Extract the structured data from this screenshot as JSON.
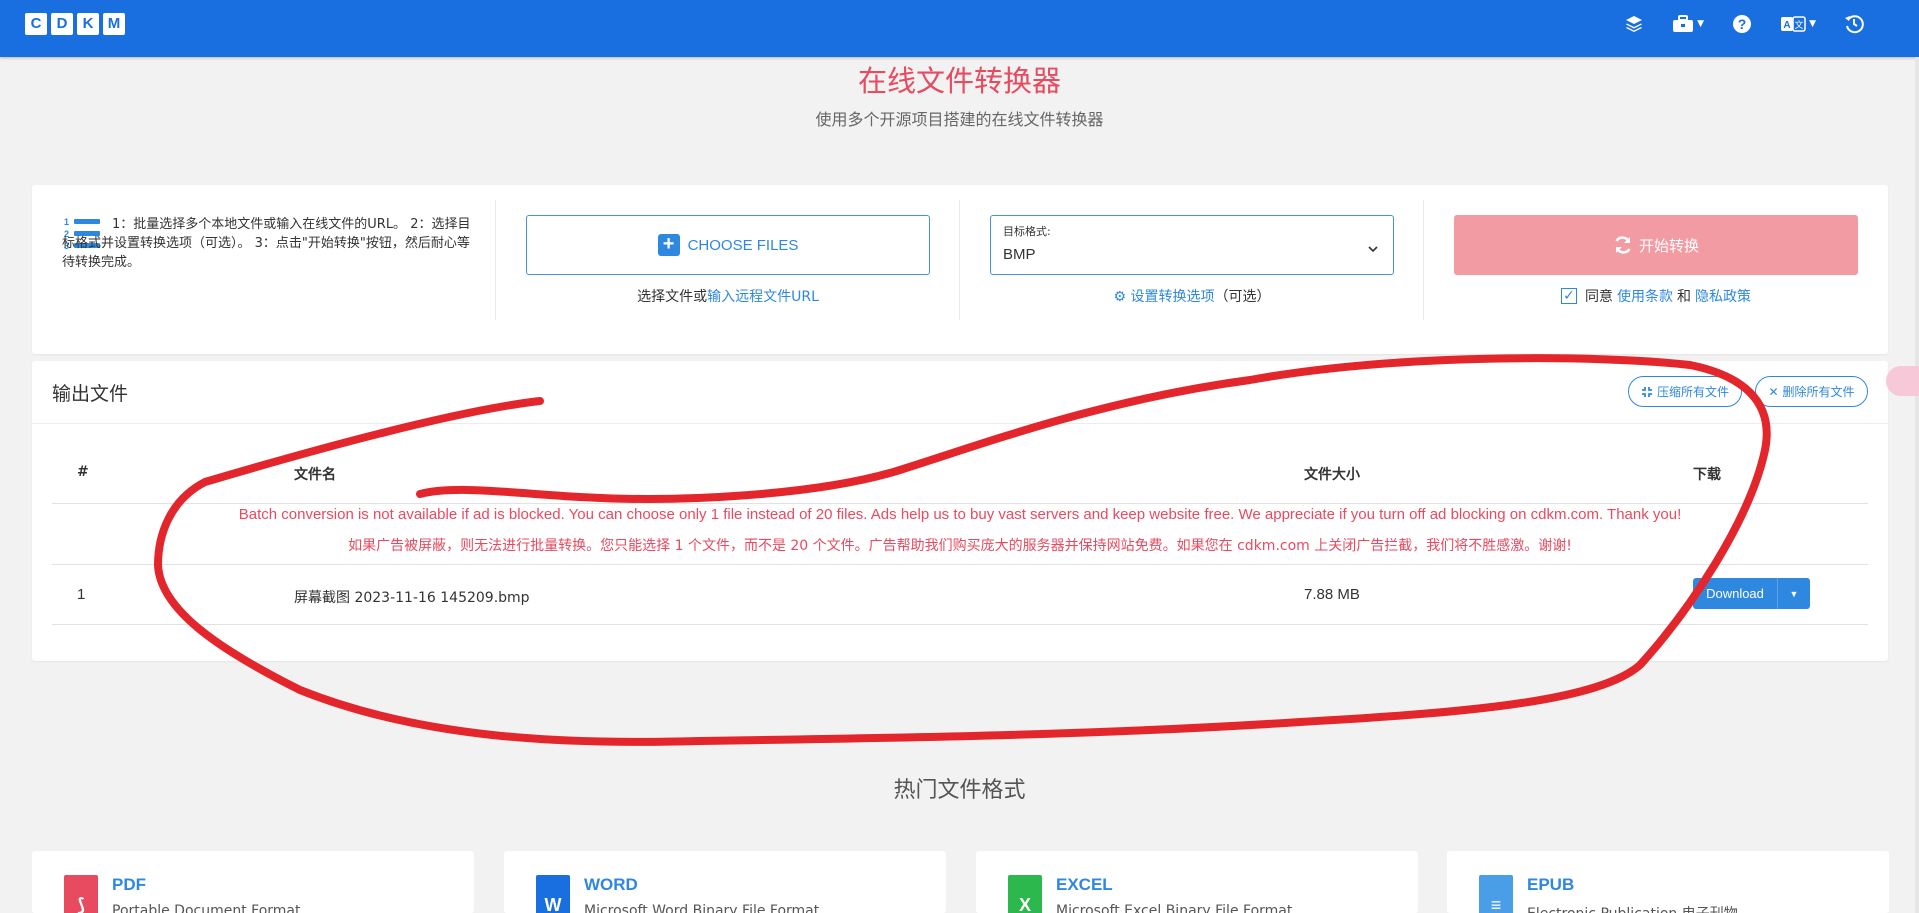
{
  "navbar": {
    "logo_letters": [
      "C",
      "D",
      "K",
      "M"
    ],
    "icons": [
      "layers-icon",
      "toolbox-icon",
      "help-icon",
      "translate-icon",
      "history-icon"
    ]
  },
  "hero": {
    "title": "在线文件转换器",
    "subtitle": "使用多个开源项目搭建的在线文件转换器"
  },
  "converter": {
    "instructions": "1：批量选择多个本地文件或输入在线文件的URL。 2：选择目标格式并设置转换选项（可选）。 3：点击\"开始转换\"按钮，然后耐心等待转换完成。",
    "choose_label": "CHOOSE FILES",
    "choose_prefix": "选择文件或",
    "choose_url_link": "输入远程文件URL",
    "format_label": "目标格式:",
    "format_value": "BMP",
    "settings_link": "设置转换选项",
    "settings_optional": "（可选）",
    "start_label": "开始转换",
    "agree_prefix": "同意",
    "terms_link": "使用条款",
    "agree_and": "和",
    "privacy_link": "隐私政策",
    "agree_checked": true
  },
  "output": {
    "title": "输出文件",
    "compress_all": "压缩所有文件",
    "delete_all": "删除所有文件",
    "columns": [
      "#",
      "文件名",
      "文件大小",
      "下载"
    ],
    "warning_en": "Batch conversion is not available if ad is blocked. You can choose only 1 file instead of 20 files. Ads help us to buy vast servers and keep website free. We appreciate if you turn off ad blocking on cdkm.com. Thank you!",
    "warning_zh": "如果广告被屏蔽，则无法进行批量转换。您只能选择 1 个文件，而不是 20 个文件。广告帮助我们购买庞大的服务器并保持网站免费。如果您在 cdkm.com 上关闭广告拦截，我们将不胜感激。谢谢!",
    "rows": [
      {
        "index": "1",
        "name": "屏幕截图 2023-11-16 145209.bmp",
        "size": "7.88 MB",
        "download_label": "Download"
      }
    ]
  },
  "popular": {
    "title": "热门文件格式",
    "cards": [
      {
        "name": "PDF",
        "desc": "Portable Document Format",
        "icon": "pdf-file-icon",
        "color": "#e84a5f"
      },
      {
        "name": "WORD",
        "desc": "Microsoft Word Binary File Format",
        "icon": "word-file-icon",
        "color": "#1a6fe0"
      },
      {
        "name": "EXCEL",
        "desc": "Microsoft Excel Binary File Format",
        "icon": "excel-file-icon",
        "color": "#2db84d"
      },
      {
        "name": "EPUB",
        "desc": "Electronic Publication 电子刊物",
        "icon": "epub-file-icon",
        "color": "#4a9ee8"
      }
    ]
  },
  "colors": {
    "navbar": "#1a6fe0",
    "accent_red": "#e84a5f",
    "link_blue": "#2f88e0",
    "start_button": "#f39ba3",
    "annotation_red": "#e3262b"
  }
}
